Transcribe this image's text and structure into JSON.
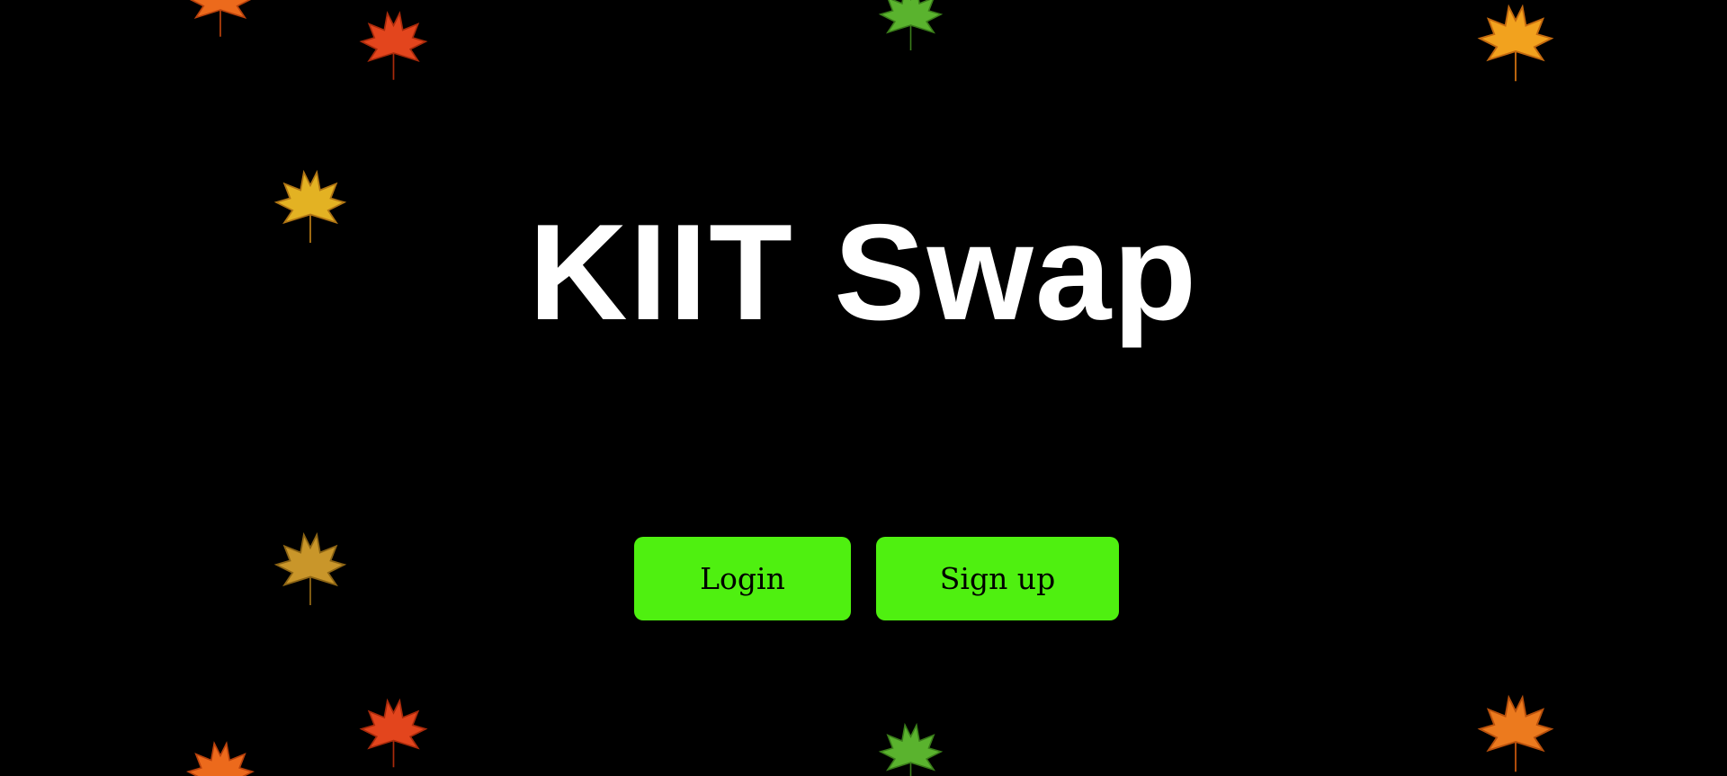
{
  "hero": {
    "title": "KIIT Swap"
  },
  "actions": {
    "login_label": "Login",
    "signup_label": "Sign up"
  },
  "colors": {
    "background": "#000000",
    "title": "#ffffff",
    "button": "#4ff010",
    "button_text": "#000000"
  },
  "decorations": {
    "icon": "maple-leaf-icon"
  }
}
